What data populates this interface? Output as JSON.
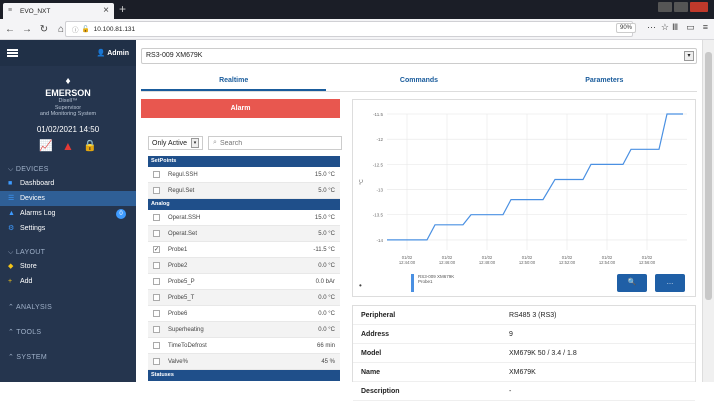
{
  "browser": {
    "tab_title": "EVO_NXT",
    "url_host": "10.100.81.131",
    "zoom": "90%"
  },
  "sidebar": {
    "user": "Admin",
    "brand": "EMERSON",
    "sub1": "Dixell™",
    "sub2": "Supervisor",
    "sub3": "and Monitoring System",
    "datetime": "01/02/2021 14:50",
    "sections": {
      "devices": "DEVICES",
      "layout": "LAYOUT",
      "analysis": "ANALYSIS",
      "tools": "TOOLS",
      "system": "SYSTEM"
    },
    "items": {
      "dashboard": "Dashboard",
      "devices": "Devices",
      "alarms_log": "Alarms Log",
      "alarms_count": "0",
      "settings": "Settings",
      "store": "Store",
      "add": "Add"
    }
  },
  "main": {
    "device_select": "RS3-009 XM679K",
    "tabs": [
      "Realtime",
      "Commands",
      "Parameters"
    ],
    "alarm_button": "Alarm",
    "filter_select": "Only Active",
    "search_placeholder": "Search",
    "table": {
      "setpoints_header": "SetPoints",
      "setpoints": [
        {
          "name": "Regul.SSH",
          "value": "15.0 °C"
        },
        {
          "name": "Regul.Set",
          "value": "5.0 °C"
        }
      ],
      "analog_header": "Analog",
      "analog": [
        {
          "name": "Operat.SSH",
          "value": "15.0 °C",
          "checked": false
        },
        {
          "name": "Operat.Set",
          "value": "5.0 °C",
          "checked": false
        },
        {
          "name": "Probe1",
          "value": "-11.5 °C",
          "checked": true
        },
        {
          "name": "Probe2",
          "value": "0.0 °C",
          "checked": false
        },
        {
          "name": "Probe5_P",
          "value": "0.0 bAr",
          "checked": false
        },
        {
          "name": "Probe5_T",
          "value": "0.0 °C",
          "checked": false
        },
        {
          "name": "Probe6",
          "value": "0.0 °C",
          "checked": false
        },
        {
          "name": "Superheating",
          "value": "0.0 °C",
          "checked": false
        },
        {
          "name": "TimeToDefrost",
          "value": "66 min",
          "checked": false
        },
        {
          "name": "Valve%",
          "value": "45 %",
          "checked": false
        }
      ],
      "statuses_header": "Statuses"
    },
    "chart_legend": [
      "RS3-009 XM679K",
      "Probe1"
    ],
    "chart_buttons": {
      "search": "🔍",
      "more": "…"
    },
    "info": [
      {
        "key": "Peripheral",
        "value": "RS485 3 (RS3)"
      },
      {
        "key": "Address",
        "value": "9"
      },
      {
        "key": "Model",
        "value": "XM679K 50 / 3.4 / 1.8"
      },
      {
        "key": "Name",
        "value": "XM679K"
      },
      {
        "key": "Description",
        "value": "-"
      }
    ]
  },
  "chart_data": {
    "type": "line",
    "ylabel": "°C",
    "yticks": [
      "-11.5",
      "-12",
      "-12.5",
      "-13",
      "-13.5",
      "-14"
    ],
    "ylim": [
      -14.2,
      -11.5
    ],
    "xticks": [
      "01/02\n12:44:00",
      "01/02\n12:46:00",
      "01/02\n12:48:00",
      "01/02\n12:50:00",
      "01/02\n12:52:00",
      "01/02\n12:54:00",
      "01/02\n12:56:00"
    ],
    "xlim": [
      0,
      7.5
    ],
    "series": [
      {
        "name": "Probe1",
        "color": "#4a90e2",
        "x": [
          0.0,
          0.5,
          1.0,
          1.2,
          1.9,
          2.1,
          2.9,
          3.1,
          3.9,
          4.2,
          4.9,
          5.1,
          5.9,
          6.1,
          6.8,
          7.0,
          7.4
        ],
        "y": [
          -14,
          -14,
          -14,
          -13.7,
          -13.7,
          -13.5,
          -13.5,
          -13.2,
          -13.2,
          -12.8,
          -12.8,
          -12.5,
          -12.5,
          -12.2,
          -12.2,
          -11.5,
          -11.5
        ]
      }
    ],
    "grid": true
  }
}
